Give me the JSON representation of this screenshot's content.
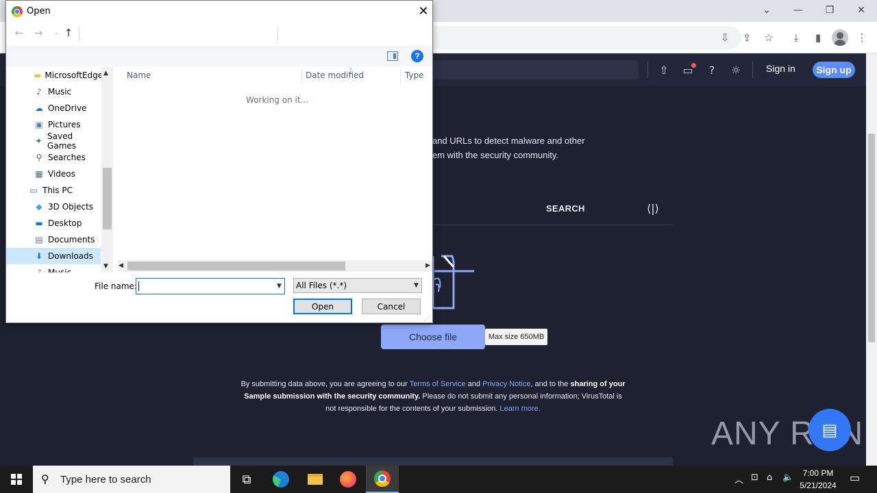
{
  "dialog": {
    "title": "Open",
    "working_text": "Working on it...",
    "columns": [
      "Name",
      "Date modified",
      "Type"
    ],
    "tree": [
      {
        "label": "MicrosoftEdge",
        "icon": "folder-icon"
      },
      {
        "label": "Music",
        "icon": "music-icon"
      },
      {
        "label": "OneDrive",
        "icon": "onedrive-icon"
      },
      {
        "label": "Pictures",
        "icon": "pictures-icon"
      },
      {
        "label": "Saved Games",
        "icon": "saved-games-icon"
      },
      {
        "label": "Searches",
        "icon": "search-icon"
      },
      {
        "label": "Videos",
        "icon": "videos-icon"
      },
      {
        "label": "This PC",
        "icon": "computer-icon"
      },
      {
        "label": "3D Objects",
        "icon": "3d-objects-icon"
      },
      {
        "label": "Desktop",
        "icon": "desktop-icon"
      },
      {
        "label": "Documents",
        "icon": "documents-icon"
      },
      {
        "label": "Downloads",
        "icon": "downloads-icon",
        "selected": true
      },
      {
        "label": "Music",
        "icon": "music-icon"
      }
    ],
    "file_name_label": "File name:",
    "file_name_value": "",
    "filter": "All Files (*.*)",
    "open_label": "Open",
    "cancel_label": "Cancel"
  },
  "vt": {
    "signin": "Sign in",
    "signup": "Sign up",
    "desc_line1": "and URLs to detect malware and other",
    "desc_line2": "em with the security community.",
    "tab_search": "SEARCH",
    "choose_file": "Choose file",
    "max_size": "Max size 650MB",
    "terms": {
      "t1": "By submitting data above, you are agreeing to our ",
      "tos": "Terms of Service",
      "t2": " and ",
      "privacy": "Privacy Notice",
      "t3": ", and to the ",
      "bold1": "sharing of your",
      "bold2": "Sample submission with the security community.",
      "t4": " Please do not submit any personal information; VirusTotal is",
      "t5": "not responsible for the contents of your submission. ",
      "learn": "Learn more."
    }
  },
  "watermark": "ANY RUN",
  "taskbar": {
    "search_placeholder": "Type here to search",
    "time": "7:00 PM",
    "date": "5/21/2024"
  }
}
